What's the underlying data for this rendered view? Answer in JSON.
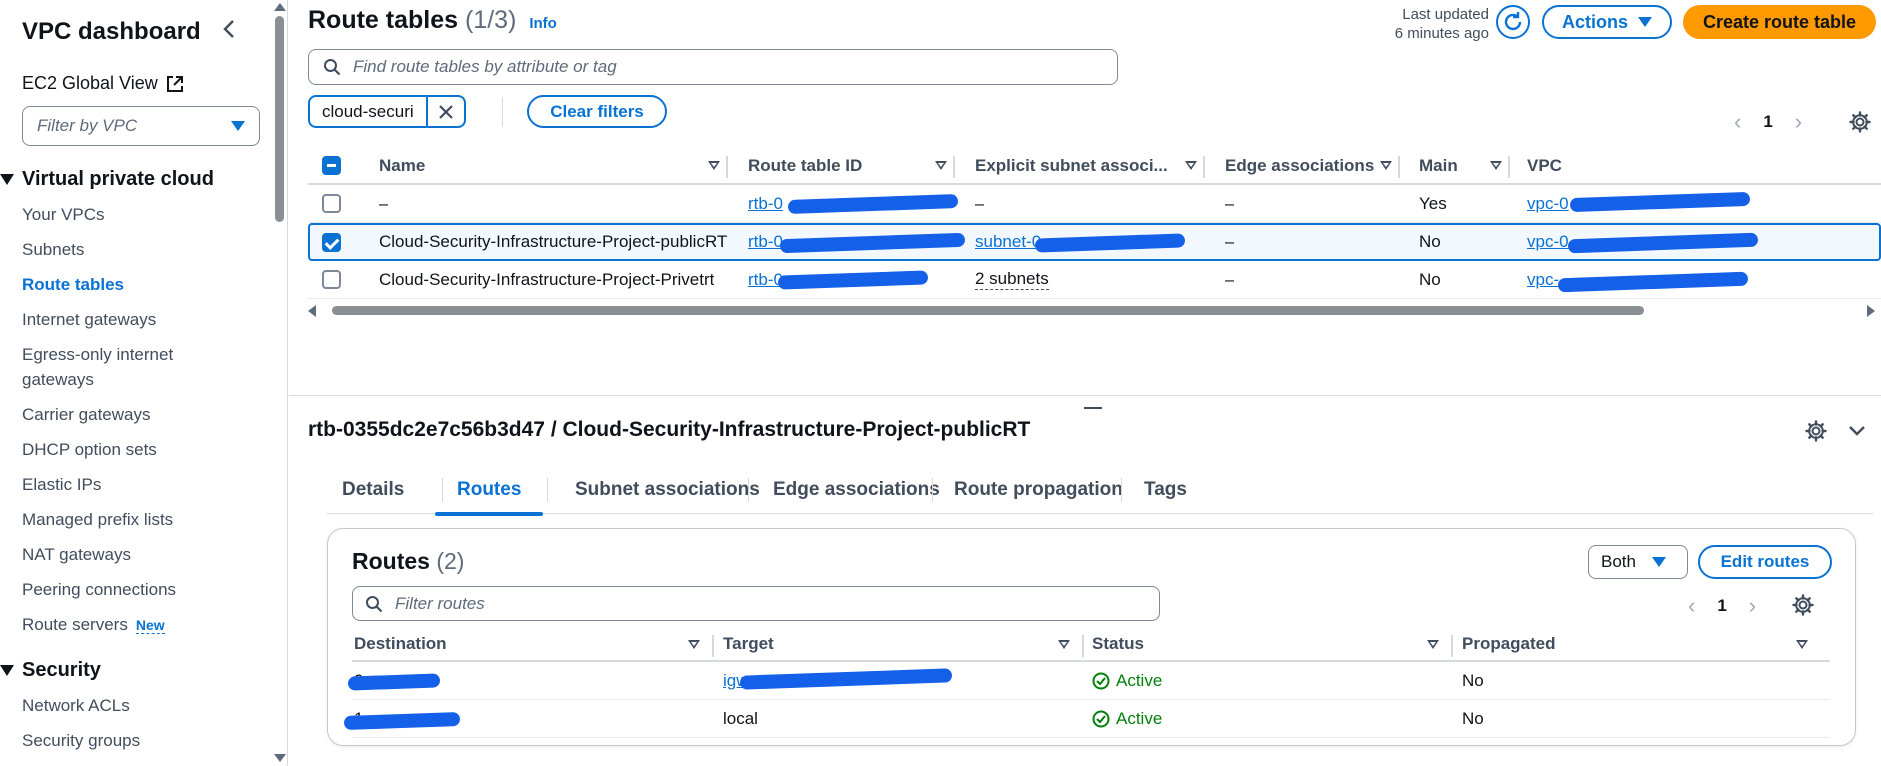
{
  "sidebar": {
    "title": "VPC dashboard",
    "ec2_global_view": "EC2 Global View",
    "filter_placeholder": "Filter by VPC",
    "sections": [
      {
        "label": "Virtual private cloud",
        "items": [
          {
            "label": "Your VPCs"
          },
          {
            "label": "Subnets"
          },
          {
            "label": "Route tables",
            "active": true
          },
          {
            "label": "Internet gateways"
          },
          {
            "label": "Egress-only internet gateways"
          },
          {
            "label": "Carrier gateways"
          },
          {
            "label": "DHCP option sets"
          },
          {
            "label": "Elastic IPs"
          },
          {
            "label": "Managed prefix lists"
          },
          {
            "label": "NAT gateways"
          },
          {
            "label": "Peering connections"
          },
          {
            "label": "Route servers",
            "badge": "New"
          }
        ]
      },
      {
        "label": "Security",
        "items": [
          {
            "label": "Network ACLs"
          },
          {
            "label": "Security groups"
          }
        ]
      }
    ]
  },
  "header": {
    "title": "Route tables",
    "count": "(1/3)",
    "info": "Info",
    "last_updated_line1": "Last updated",
    "last_updated_line2": "6 minutes ago",
    "actions_label": "Actions",
    "create_label": "Create route table"
  },
  "search": {
    "placeholder": "Find route tables by attribute or tag",
    "filter_token": "cloud-securi",
    "clear_filters": "Clear filters"
  },
  "pagination": {
    "page": "1"
  },
  "route_tables": {
    "columns": [
      "Name",
      "Route table ID",
      "Explicit subnet associ...",
      "Edge associations",
      "Main",
      "VPC"
    ],
    "rows": [
      {
        "name": "–",
        "route_table_id": "rtb-0",
        "explicit_subnet": "–",
        "edge": "–",
        "main": "Yes",
        "vpc": "vpc-0",
        "selected": false
      },
      {
        "name": "Cloud-Security-Infrastructure-Project-publicRT",
        "route_table_id": "rtb-0",
        "explicit_subnet": "subnet-0",
        "edge": "–",
        "main": "No",
        "vpc": "vpc-0",
        "selected": true
      },
      {
        "name": "Cloud-Security-Infrastructure-Project-Privetrt",
        "route_table_id": "rtb-0",
        "explicit_subnet": "2 subnets",
        "edge": "–",
        "main": "No",
        "vpc": "vpc-",
        "selected": false
      }
    ]
  },
  "detail": {
    "title": "rtb-0355dc2e7c56b3d47 / Cloud-Security-Infrastructure-Project-publicRT",
    "tabs": [
      {
        "label": "Details"
      },
      {
        "label": "Routes",
        "active": true
      },
      {
        "label": "Subnet associations"
      },
      {
        "label": "Edge associations"
      },
      {
        "label": "Route propagation"
      },
      {
        "label": "Tags"
      }
    ],
    "routes": {
      "title": "Routes",
      "count": "(2)",
      "filter_select": "Both",
      "edit_label": "Edit routes",
      "search_placeholder": "Filter routes",
      "page": "1",
      "columns": [
        "Destination",
        "Target",
        "Status",
        "Propagated"
      ],
      "rows": [
        {
          "destination": "0",
          "target": "igw-",
          "status": "Active",
          "propagated": "No"
        },
        {
          "destination": "1",
          "target": "local",
          "status": "Active",
          "propagated": "No"
        }
      ]
    }
  },
  "colors": {
    "accent": "#0972d3",
    "primary_button": "#ff9900",
    "success": "#037f0c",
    "redaction": "#1560e8"
  }
}
